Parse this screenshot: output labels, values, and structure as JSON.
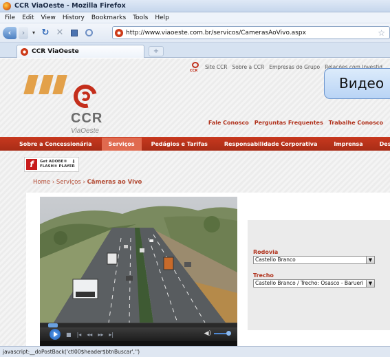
{
  "window": {
    "title": "CCR ViaOeste - Mozilla Firefox"
  },
  "menu": [
    "File",
    "Edit",
    "View",
    "History",
    "Bookmarks",
    "Tools",
    "Help"
  ],
  "address": {
    "url": "http://www.viaoeste.com.br/servicos/CamerasAoVivo.aspx"
  },
  "tab": {
    "title": "CCR ViaOeste",
    "new_tab": "+"
  },
  "site": {
    "top_links": [
      "Site CCR",
      "Sobre a CCR",
      "Empresas do Grupo",
      "Relações com Investid"
    ],
    "mini_logo": "CCR",
    "logo_text": "CCR",
    "logo_sub": "ViaOeste",
    "header_links": [
      "Fale Conosco",
      "Perguntas Frequentes",
      "Trabalhe Conosco"
    ],
    "nav": [
      "Sobre a Concessionária",
      "Serviços",
      "Pedágios e Tarifas",
      "Responsabilidade Corporativa",
      "Imprensa",
      "Destaques"
    ],
    "flash": {
      "line1": "Get ADOBE®",
      "line2": "FLASH® PLAYER",
      "glyph": "f"
    },
    "breadcrumb": {
      "home": "Home",
      "sep": "›",
      "section": "Serviços",
      "current": "Câmeras ao Vivo"
    },
    "form": {
      "rodovia_label": "Rodovia",
      "rodovia_value": "Castello Branco",
      "trecho_label": "Trecho",
      "trecho_value": "Castello Branco / Trecho: Osasco - Barueri"
    }
  },
  "overlay": {
    "text": "Видео"
  },
  "status": {
    "text": "javascript:__doPostBack('ctl00$header$btnBuscar','')"
  },
  "colors": {
    "brand_red": "#c42e1b",
    "nav_red": "#b8321a",
    "accent_blue": "#4c7fc1"
  }
}
